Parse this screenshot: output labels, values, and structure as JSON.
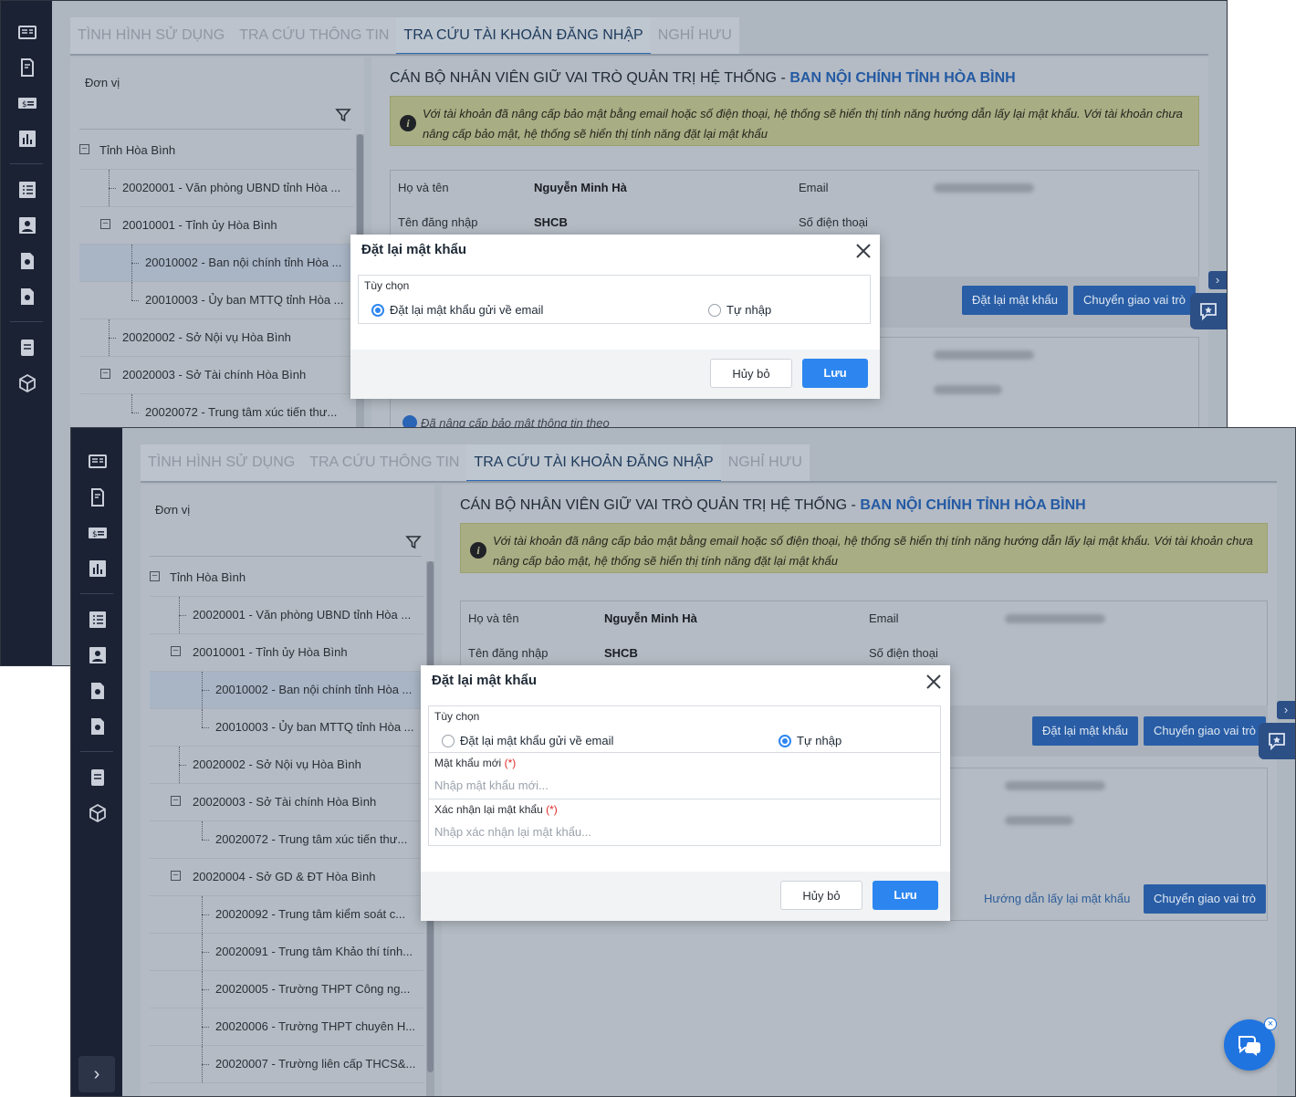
{
  "tabs": [
    "TÌNH HÌNH SỬ DỤNG",
    "TRA CỨU THÔNG TIN",
    "TRA CỨU TÀI KHOẢN ĐĂNG NHẬP",
    "NGHỈ HƯU"
  ],
  "active_tab": "TRA CỨU TÀI KHOẢN ĐĂNG NHẬP",
  "left": {
    "label": "Đơn vị",
    "tree": [
      {
        "text": "Tỉnh Hòa Bình"
      },
      {
        "text": "20020001 - Văn phòng UBND tỉnh Hòa ..."
      },
      {
        "text": "20010001 - Tỉnh ủy Hòa Bình"
      },
      {
        "text": "20010002 - Ban nội chính tỉnh Hòa ..."
      },
      {
        "text": "20010003 - Ủy ban MTTQ tỉnh Hòa ..."
      },
      {
        "text": "20020002 - Sở Nội vụ Hòa Bình"
      },
      {
        "text": "20020003 - Sở Tài chính Hòa Bình"
      },
      {
        "text": "20020072 - Trung tâm xúc tiến thư..."
      },
      {
        "text": "20020004 - Sở GD & ĐT Hòa Bình"
      },
      {
        "text": "20020092 - Trung tâm kiểm soát c..."
      },
      {
        "text": "20020091 - Trung tâm Khảo thí tính..."
      },
      {
        "text": "20020005 - Trường THPT Công ng..."
      },
      {
        "text": "20020006 - Trường THPT chuyên H..."
      },
      {
        "text": "20020007 - Trường liên cấp THCS&..."
      }
    ]
  },
  "right": {
    "title_prefix": "CÁN BỘ NHÂN VIÊN GIỮ VAI TRÒ QUẢN TRỊ HỆ THỐNG -",
    "title_unit": "BAN NỘI CHÍNH TỈNH HÒA BÌNH",
    "info": "Với tài khoản đã nâng cấp bảo mật bằng email hoặc số điện thoại, hệ thống sẽ hiển thị tính năng hướng dẫn lấy lại mật khẩu. Với tài khoản chưa nâng cấp bảo mật, hệ thống sẽ hiển thị tính năng đặt lại mật khẩu",
    "card": {
      "name_label": "Họ và tên",
      "name_value": "Nguyễn Minh Hà",
      "email_label": "Email",
      "username_label": "Tên đăng nhập",
      "username_value": "SHCB",
      "phone_label": "Số điện thoại"
    },
    "buttons": {
      "reset": "Đặt lại mật khẩu",
      "transfer": "Chuyển giao vai trò",
      "guide": "Hướng dẫn lấy lại mật khẩu"
    },
    "verified_text": "Đã nâng cấp bảo mật thông tin theo"
  },
  "dialog_top": {
    "title": "Đặt lại mật khẩu",
    "option_label": "Tùy chọn",
    "radio_email": "Đặt lại mật khẩu gửi về email",
    "radio_manual": "Tự nhập",
    "selected": "email",
    "cancel": "Hủy bỏ",
    "save": "Lưu"
  },
  "dialog_bottom": {
    "title": "Đặt lại mật khẩu",
    "option_label": "Tùy chọn",
    "radio_email": "Đặt lại mật khẩu gửi về email",
    "radio_manual": "Tự nhập",
    "selected": "manual",
    "new_password_label": "Mật khẩu mới",
    "new_password_placeholder": "Nhập mật khẩu mới...",
    "confirm_label": "Xác nhận lại mật khẩu",
    "confirm_placeholder": "Nhập xác nhận lại mật khẩu...",
    "required_mark": "(*)",
    "cancel": "Hủy bỏ",
    "save": "Lưu"
  },
  "colors": {
    "primary": "#2d86f0",
    "rail": "#1b2234",
    "unit_title": "#245aa3",
    "required": "#e02b2b"
  }
}
